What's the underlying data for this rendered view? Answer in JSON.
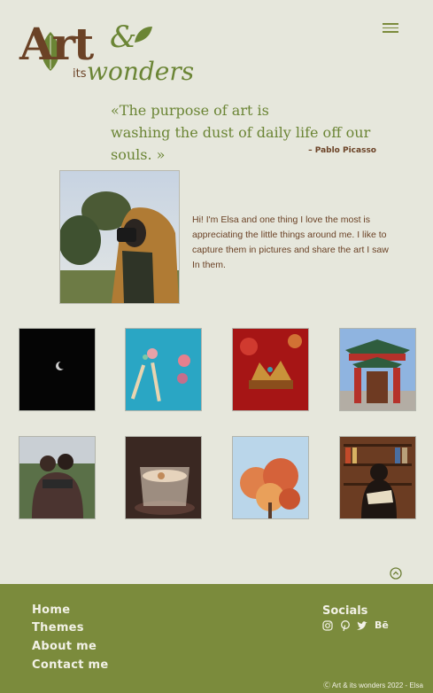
{
  "logo": {
    "art": "Art",
    "amp": "&",
    "its": "its",
    "wonders": "wonders"
  },
  "icons": {
    "menu": "hamburger-menu-icon",
    "scroll_top": "chevron-up-circle-icon",
    "instagram": "instagram-icon",
    "pinterest": "pinterest-icon",
    "twitter": "twitter-icon",
    "behance": "behance-icon"
  },
  "quote": {
    "line1": "«The purpose of art is",
    "line2": "washing the dust of daily life off our souls. »",
    "author": "– Pablo Picasso"
  },
  "intro": {
    "text": "Hi! I'm Elsa and one thing I love the most is appreciating the little things around me. I like to capture them in pictures and share the art I saw In them."
  },
  "footer": {
    "nav": [
      "Home",
      "Themes",
      "About me",
      "Contact me"
    ],
    "socials_title": "Socials",
    "behance_label": "Bē",
    "copyright": "Ⓒ Art & its wonders 2022 - Elsa"
  },
  "colors": {
    "background": "#e6e7dc",
    "brown": "#6b4226",
    "olive": "#7b8b3c",
    "footer_text": "#f2f1e6"
  }
}
